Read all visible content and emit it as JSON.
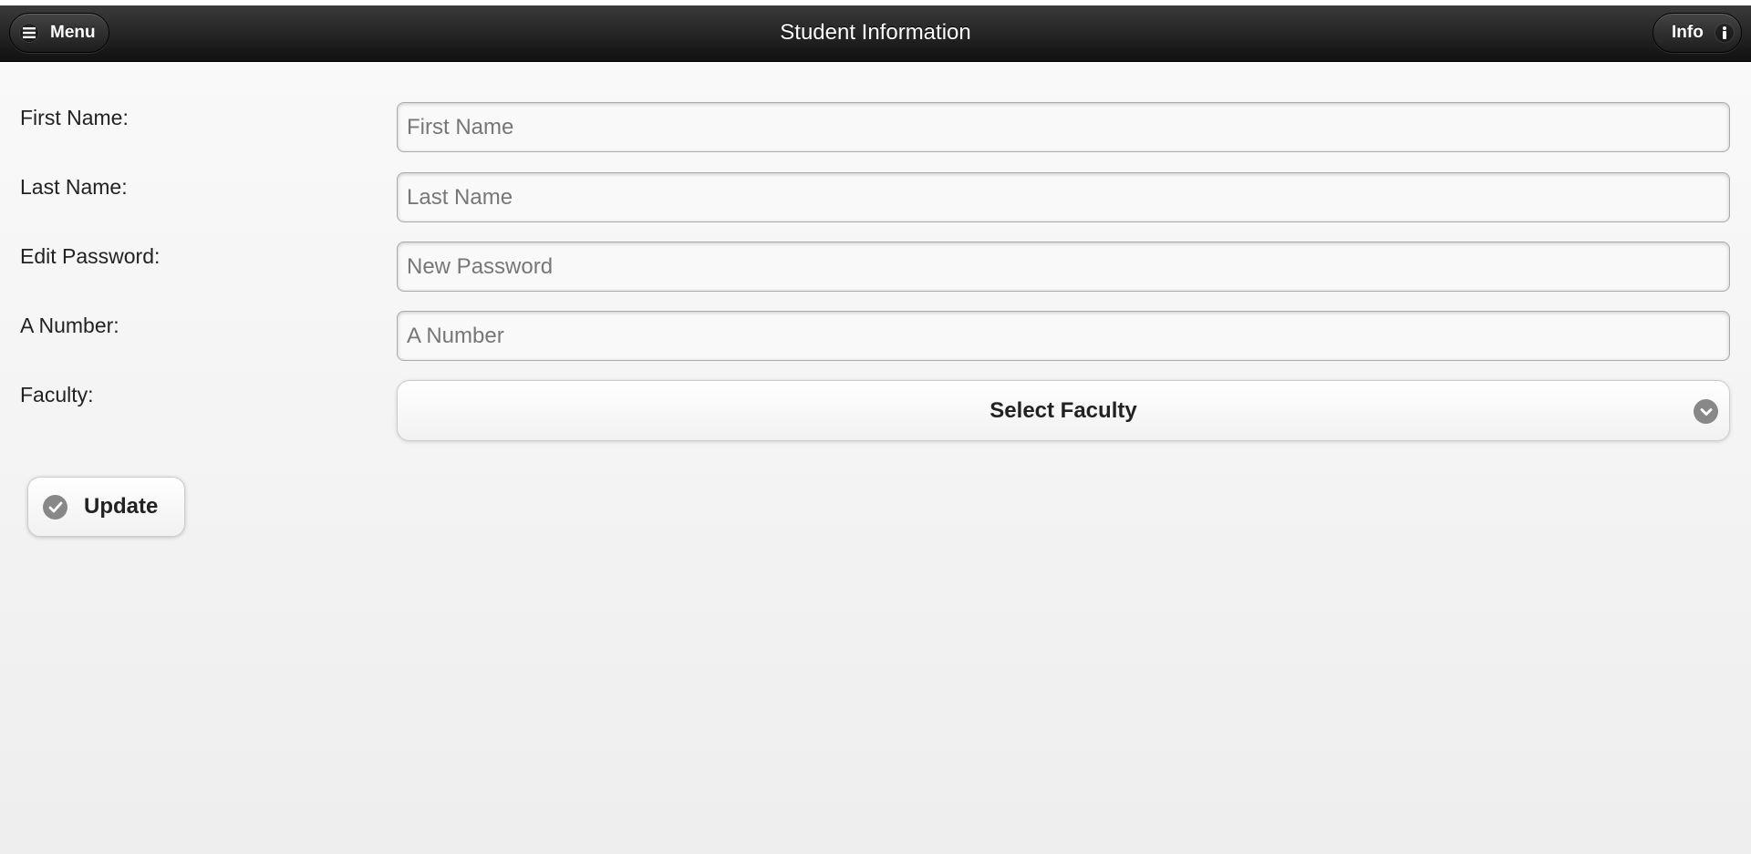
{
  "header": {
    "title": "Student Information",
    "menu_label": "Menu",
    "info_label": "Info"
  },
  "form": {
    "first_name": {
      "label": "First Name:",
      "placeholder": "First Name",
      "value": ""
    },
    "last_name": {
      "label": "Last Name:",
      "placeholder": "Last Name",
      "value": ""
    },
    "password": {
      "label": "Edit Password:",
      "placeholder": "New Password",
      "value": ""
    },
    "a_number": {
      "label": "A Number:",
      "placeholder": "A Number",
      "value": ""
    },
    "faculty": {
      "label": "Faculty:",
      "selected": "Select Faculty"
    }
  },
  "actions": {
    "update_label": "Update"
  },
  "icons": {
    "menu": "bars-icon",
    "info": "info-icon",
    "select": "chevron-down-icon",
    "update": "check-icon"
  },
  "colors": {
    "header_dark": "#111111",
    "icon_gray": "#888888"
  }
}
